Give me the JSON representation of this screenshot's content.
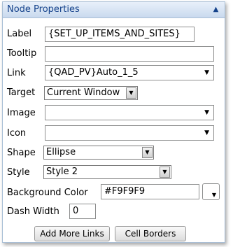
{
  "panel": {
    "title": "Node Properties",
    "collapse_icon": "chevron-up-icon"
  },
  "fields": {
    "label": {
      "label": "Label",
      "value": "{SET_UP_ITEMS_AND_SITES}"
    },
    "tooltip": {
      "label": "Tooltip",
      "value": ""
    },
    "link": {
      "label": "Link",
      "value": "{QAD_PV}Auto_1_5"
    },
    "target": {
      "label": "Target",
      "value": "Current Window"
    },
    "image": {
      "label": "Image",
      "value": ""
    },
    "icon": {
      "label": "Icon",
      "value": ""
    },
    "shape": {
      "label": "Shape",
      "value": "Ellipse"
    },
    "style": {
      "label": "Style",
      "value": "Style 2"
    },
    "background_color": {
      "label": "Background Color",
      "value": "#F9F9F9"
    },
    "dash_width": {
      "label": "Dash Width",
      "value": "0"
    }
  },
  "buttons": {
    "add_more_links": "Add More Links",
    "cell_borders": "Cell Borders"
  },
  "colors": {
    "title_text": "#15428b",
    "border": "#a9bfd6"
  }
}
